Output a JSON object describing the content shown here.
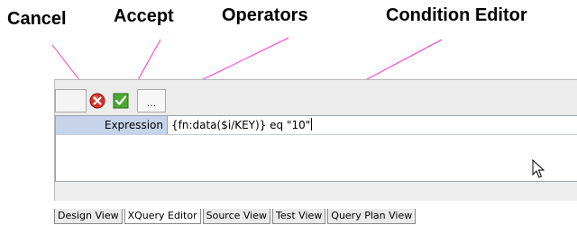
{
  "callouts": {
    "cancel": "Cancel",
    "accept": "Accept",
    "operators": "Operators",
    "condition_editor": "Condition Editor"
  },
  "toolbar": {
    "cancel_icon": "cancel-icon",
    "accept_icon": "accept-icon",
    "operators_label": "..."
  },
  "editor": {
    "field_label": "Expression",
    "field_value": "{fn:data($i/KEY)} eq \"10\""
  },
  "tabs": [
    {
      "label": "Design View",
      "active": false
    },
    {
      "label": "XQuery Editor",
      "active": true
    },
    {
      "label": "Source View",
      "active": false
    },
    {
      "label": "Test View",
      "active": false
    },
    {
      "label": "Query Plan View",
      "active": false
    }
  ],
  "colors": {
    "leader_line": "#ff33cc",
    "cancel_red": "#d8302a",
    "accept_green": "#4aa82e",
    "label_bg": "#c6d3ea"
  }
}
